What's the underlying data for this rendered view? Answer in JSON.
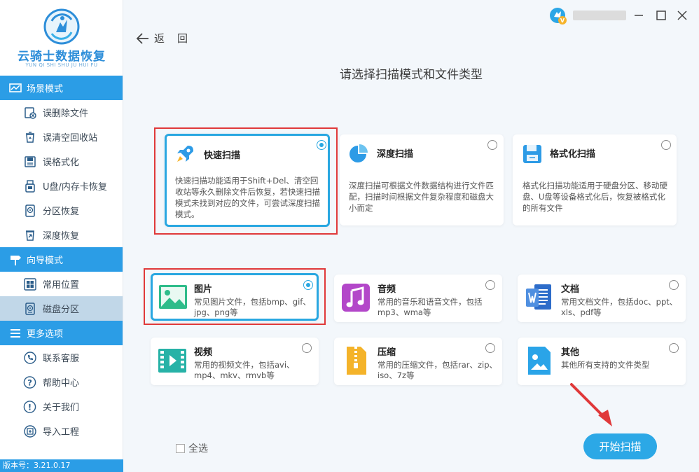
{
  "app": {
    "name": "云骑士数据恢复",
    "pinyin": "YUN QI SHI SHU JU HUI FU",
    "version": "版本号：3.21.0.17"
  },
  "sidebar": {
    "sections": [
      {
        "label": "场景模式",
        "items": [
          "误删除文件",
          "误清空回收站",
          "误格式化",
          "U盘/内存卡恢复",
          "分区恢复",
          "深度恢复"
        ]
      },
      {
        "label": "向导模式",
        "items": [
          "常用位置",
          "磁盘分区"
        ]
      },
      {
        "label": "更多选项",
        "items": [
          "联系客服",
          "帮助中心",
          "关于我们",
          "导入工程"
        ]
      }
    ],
    "active_item": "磁盘分区"
  },
  "header": {
    "back_label": "返回",
    "title": "请选择扫描模式和文件类型"
  },
  "scan_modes": [
    {
      "title": "快速扫描",
      "desc": "快速扫描功能适用于Shift+Del、清空回收站等永久删除文件后恢复，若快速扫描模式未找到对应的文件，可尝试深度扫描模式。",
      "selected": true,
      "icon": "rocket-icon"
    },
    {
      "title": "深度扫描",
      "desc": "深度扫描可根据文件数据结构进行文件匹配，扫描时间根据文件复杂程度和磁盘大小而定",
      "selected": false,
      "icon": "pie-chart-icon"
    },
    {
      "title": "格式化扫描",
      "desc": "格式化扫描功能适用于硬盘分区、移动硬盘、U盘等设备格式化后，恢复被格式化的所有文件",
      "selected": false,
      "icon": "floppy-disk-icon"
    }
  ],
  "file_types": [
    {
      "title": "图片",
      "desc": "常见图片文件，包括bmp、gif、jpg、png等",
      "selected": true,
      "icon": "image-icon",
      "color": "#2ebc8a"
    },
    {
      "title": "音频",
      "desc": "常用的音乐和语音文件，包括mp3、wma等",
      "selected": false,
      "icon": "music-icon",
      "color": "#b347c9"
    },
    {
      "title": "文档",
      "desc": "常用文档文件，包括doc、ppt、xls、pdf等",
      "selected": false,
      "icon": "document-icon",
      "color": "#2d6cc9"
    },
    {
      "title": "视频",
      "desc": "常用的视频文件，包括avi、mp4、mkv、rmvb等",
      "selected": false,
      "icon": "video-icon",
      "color": "#27b2a7"
    },
    {
      "title": "压缩",
      "desc": "常用的压缩文件，包括rar、zip、iso、7z等",
      "selected": false,
      "icon": "archive-icon",
      "color": "#f4b32a"
    },
    {
      "title": "其他",
      "desc": "其他所有支持的文件类型",
      "selected": false,
      "icon": "other-file-icon",
      "color": "#2aa4e8"
    }
  ],
  "footer": {
    "select_all_label": "全选",
    "start_label": "开始扫描"
  },
  "colors": {
    "accent": "#2b9de6",
    "highlight": "#e0393a"
  }
}
